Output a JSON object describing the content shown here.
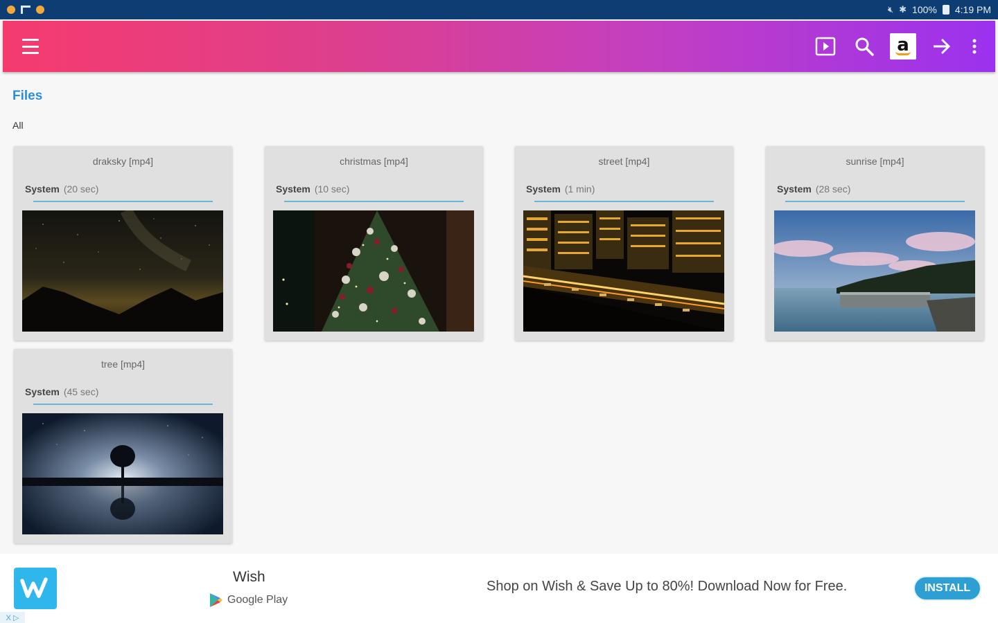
{
  "status_bar": {
    "battery": "100%",
    "time": "4:19 PM"
  },
  "app_bar": {
    "icons": [
      "menu-icon",
      "play-box-icon",
      "search-icon",
      "amazon-icon",
      "arrow-right-icon",
      "more-vert-icon"
    ]
  },
  "section": {
    "title": "Files",
    "filter": "All"
  },
  "files": [
    {
      "name": "draksky [mp4]",
      "source": "System",
      "duration": "(20 sec)"
    },
    {
      "name": "christmas [mp4]",
      "source": "System",
      "duration": "(10 sec)"
    },
    {
      "name": "street [mp4]",
      "source": "System",
      "duration": "(1 min)"
    },
    {
      "name": "sunrise [mp4]",
      "source": "System",
      "duration": "(28 sec)"
    },
    {
      "name": "tree [mp4]",
      "source": "System",
      "duration": "(45 sec)"
    }
  ],
  "ad": {
    "app_name": "Wish",
    "store": "Google Play",
    "text": "Shop on Wish & Save Up to 80%! Download Now for Free.",
    "button": "INSTALL",
    "marker": "X ▷"
  },
  "colors": {
    "status_bar": "#0e3d74",
    "gradient_start": "#f53b6e",
    "gradient_end": "#9b32ee",
    "title_blue": "#2a8fd8",
    "install_blue": "#2d9fd3"
  }
}
